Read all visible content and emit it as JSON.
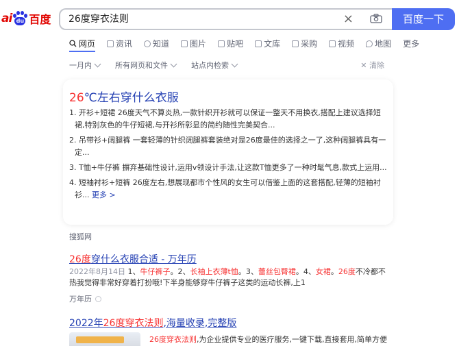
{
  "logo": {
    "ai": "ai",
    "du": "du",
    "bd": "百度"
  },
  "search": {
    "query": "26度穿衣法则",
    "button": "百度一下"
  },
  "tabs": [
    {
      "label": "网页",
      "icon": "search-icon",
      "active": true
    },
    {
      "label": "资讯",
      "icon": "news-icon"
    },
    {
      "label": "知道",
      "icon": "question-icon"
    },
    {
      "label": "图片",
      "icon": "image-icon"
    },
    {
      "label": "贴吧",
      "icon": "tieba-icon"
    },
    {
      "label": "文库",
      "icon": "document-icon"
    },
    {
      "label": "采购",
      "icon": "purchase-icon"
    },
    {
      "label": "视频",
      "icon": "video-icon"
    },
    {
      "label": "地图",
      "icon": "map-icon"
    },
    {
      "label": "更多",
      "icon": ""
    }
  ],
  "filters": {
    "time": "一月内",
    "type": "所有网页和文件",
    "site": "站点内检索",
    "clear": "清除"
  },
  "card": {
    "title_hl": "26",
    "title_rest": "℃左右穿什么衣服",
    "items": [
      "1. 开衫+短裙 26度天气不算炎热,一款针织开衫就可以保证一整天不用换衣,搭配上建议选择短裙,特别灰色的牛仔短裙,与开衫所彰显的简约随性完美契合...",
      "2. 吊带衫+阔腿裤 一套轻薄的针织阔腿裤套装绝对是26度最佳的选择之一了,这种阔腿裤具有一定...",
      "3. T恤+牛仔裤 摒弃基础性设计,运用v领设计手法,让这款T恤更多了一种时髦气息,款式上运用...",
      "4. 短袖衬衫+短裤 26度左右,想展现都市个性风的女生可以借鉴上面的这套搭配,轻薄的短袖衬衫..."
    ],
    "more": "更多 >"
  },
  "source1": "搜狐网",
  "result1": {
    "title_hl": "26度",
    "title_rest": "穿什么衣服合适 - 万年历",
    "date": "2022年8月14日",
    "snippet_a": "1、",
    "snippet_hl1": "牛仔裤子",
    "snippet_b": "。2、",
    "snippet_hl2": "长袖上衣薄t恤",
    "snippet_c": "。3、",
    "snippet_hl3": "蕾丝包臀裙",
    "snippet_d": "。4、",
    "snippet_hl4": "女裙",
    "snippet_e": "。",
    "snippet_hl5": "26度",
    "snippet_f": "不冷都不热我觉得非常好穿着打扮哦!下半身能够穿牛仔裤子这类的运动长裤,上1",
    "source": "万年历"
  },
  "result2": {
    "title_pre": "2022年",
    "title_hl": "26度穿衣法则",
    "title_rest": ",海量收录,完整版",
    "snippet_hl": "26度穿衣法则",
    "snippet_rest": ",为企业提供专业的医疗服务,一键下载,直接套用,简单方便"
  },
  "colors": {
    "accent": "#4e6ef2",
    "link": "#2440b3",
    "highlight": "#f73131",
    "brand_red": "#e10602",
    "brand_blue": "#2932e1"
  }
}
